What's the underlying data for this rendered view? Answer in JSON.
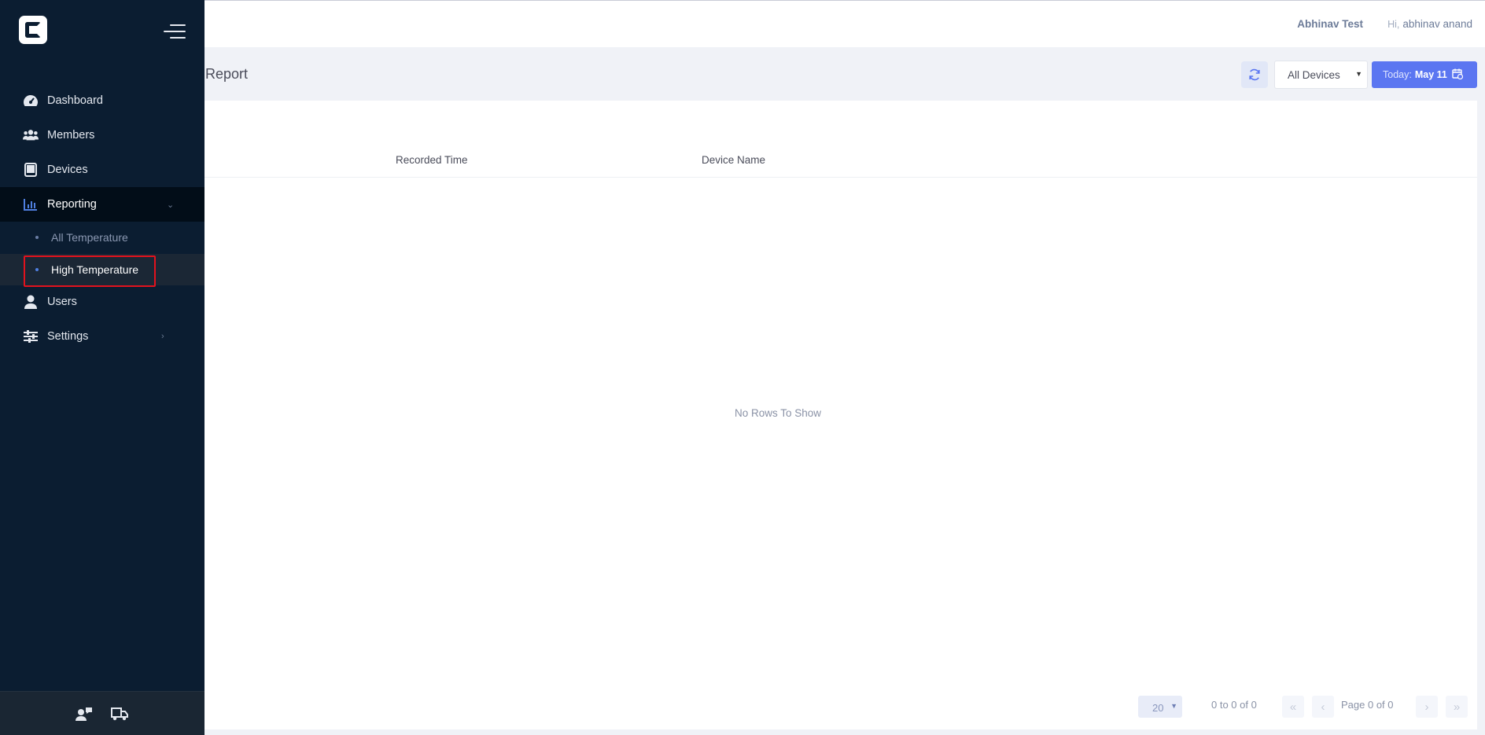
{
  "colors": {
    "sidebar_bg": "#0b1d31",
    "active_bg": "#020d18",
    "accent": "#5b76f1",
    "highlight_border": "#e3121d"
  },
  "sidebar": {
    "items": [
      {
        "label": "Dashboard",
        "icon": "speedometer-icon"
      },
      {
        "label": "Members",
        "icon": "users-icon"
      },
      {
        "label": "Devices",
        "icon": "tablet-icon"
      },
      {
        "label": "Reporting",
        "icon": "bar-chart-icon",
        "active": true,
        "expanded": true
      },
      {
        "label": "Users",
        "icon": "user-icon"
      },
      {
        "label": "Settings",
        "icon": "sliders-icon"
      }
    ],
    "reporting_sub": [
      {
        "label": "All Temperature"
      },
      {
        "label": "High Temperature",
        "selected": true
      }
    ],
    "footer_icons": [
      "user-chat-icon",
      "truck-icon"
    ]
  },
  "header": {
    "user_name": "Abhinav Test",
    "greeting_hi": "Hi,",
    "greeting_name": "abhinav anand"
  },
  "page": {
    "title": "Report",
    "device_filter": "All Devices",
    "date_prefix": "Today:",
    "date_value": "May 11"
  },
  "grid": {
    "columns": [
      "Recorded Time",
      "Device Name"
    ],
    "empty_message": "No Rows To Show",
    "page_size": "20",
    "row_info": "0 to 0 of 0",
    "page_info": "Page 0 of 0"
  }
}
